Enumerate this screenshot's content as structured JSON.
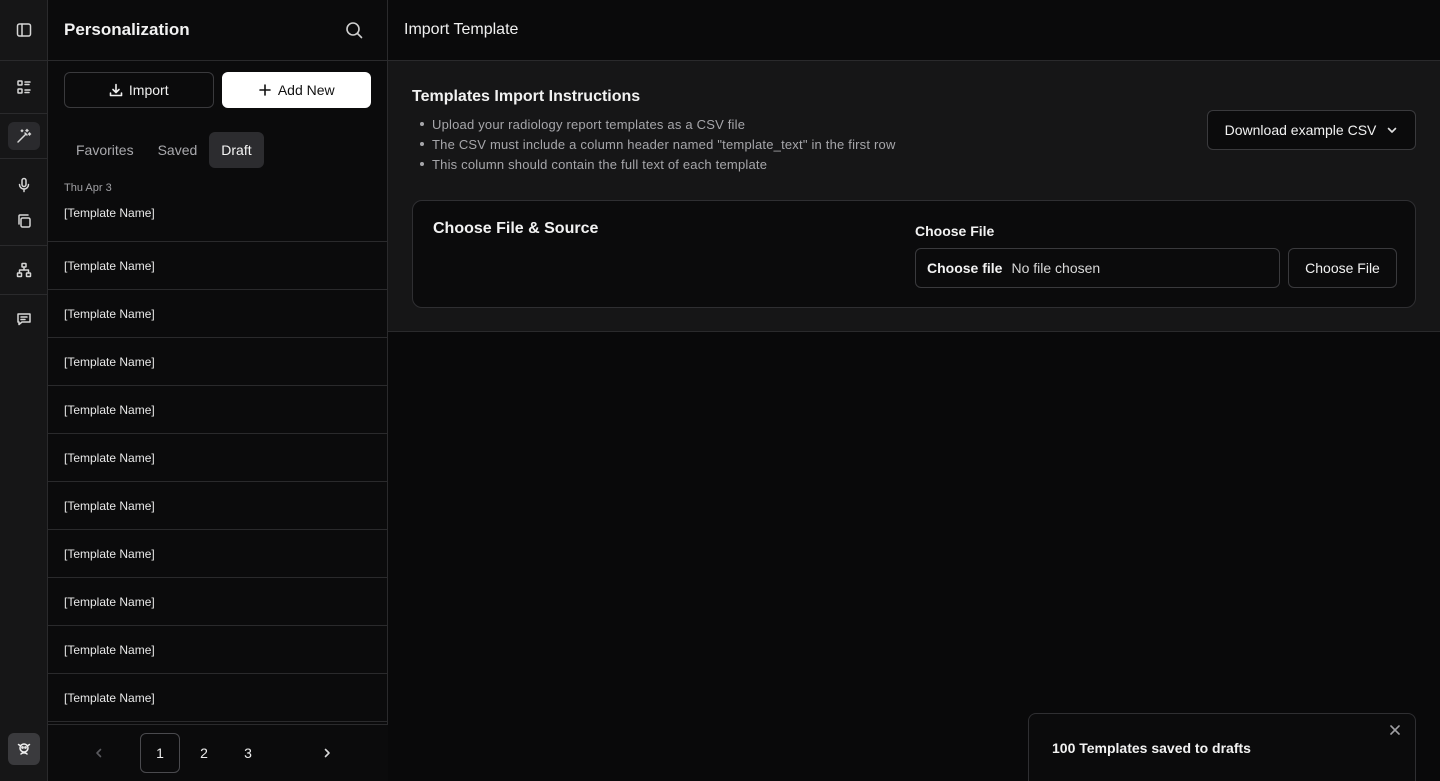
{
  "sidebar": {
    "title": "Personalization",
    "import_label": "Import",
    "add_new_label": "Add New",
    "tabs": [
      {
        "label": "Favorites",
        "active": false
      },
      {
        "label": "Saved",
        "active": false
      },
      {
        "label": "Draft",
        "active": true
      }
    ],
    "date_label": "Thu Apr 3",
    "items": [
      "[Template Name]",
      "[Template Name]",
      "[Template Name]",
      "[Template Name]",
      "[Template Name]",
      "[Template Name]",
      "[Template Name]",
      "[Template Name]",
      "[Template Name]",
      "[Template Name]",
      "[Template Name]"
    ],
    "pagination": {
      "pages": [
        "1",
        "2",
        "3"
      ],
      "current": "1"
    }
  },
  "rail": {
    "icons": [
      "sidebar-toggle-icon",
      "list-icon",
      "magic-wand-icon",
      "microphone-icon",
      "copy-icon",
      "hierarchy-icon",
      "message-icon",
      "avatar-icon"
    ],
    "active": "magic-wand-icon"
  },
  "main": {
    "header_title": "Import Template",
    "instructions": {
      "title": "Templates Import Instructions",
      "items": [
        "Upload your radiology report templates as a CSV file",
        "The CSV must include a column header named \"template_text\" in the first row",
        "This column should contain the full text of each template"
      ],
      "download_label": "Download example CSV"
    },
    "card": {
      "title": "Choose File & Source",
      "field_label": "Choose File",
      "file_input_button": "Choose file",
      "file_input_status": "No file chosen",
      "choose_button": "Choose File"
    }
  },
  "toast": {
    "message": "100 Templates saved to drafts"
  },
  "colors": {
    "background": "#0a0a0b",
    "panel": "#161617",
    "border": "#2a2a2c",
    "primary_button": "#ffffff",
    "active_tab": "#2c2c2f"
  }
}
